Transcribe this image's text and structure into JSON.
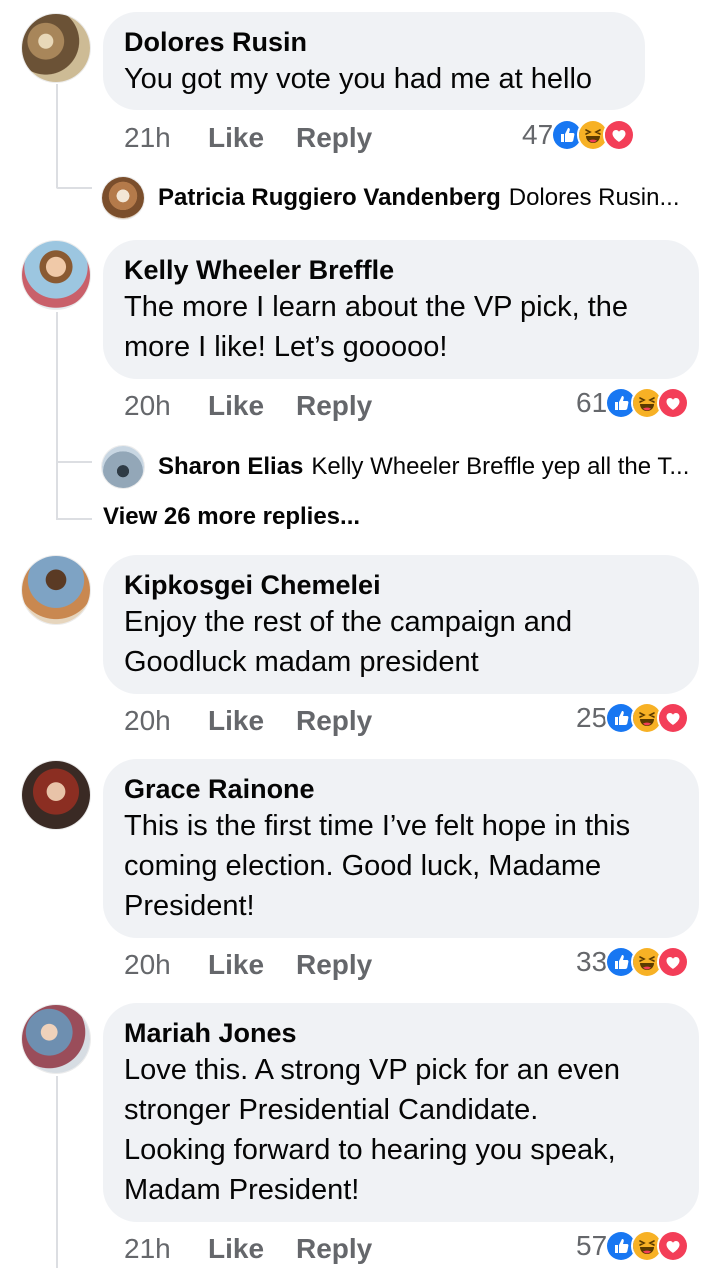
{
  "colors": {
    "like_blue": "#1877f2",
    "haha_yellow": "#f7b125",
    "love_red": "#f33e58",
    "muted_text": "#65676b",
    "bubble_bg": "#f0f2f5"
  },
  "comments": [
    {
      "author": "Dolores Rusin",
      "text": "You got my vote you had me at hello",
      "time": "21h",
      "like_label": "Like",
      "reply_label": "Reply",
      "reaction_count": "47",
      "reactions": [
        "like-icon",
        "haha-icon",
        "love-icon"
      ],
      "reply_preview": {
        "author": "Patricia Ruggiero Vandenberg",
        "text": "Dolores Rusin..."
      }
    },
    {
      "author": "Kelly Wheeler Breffle",
      "text": "The more I learn about the VP pick, the\nmore I like! Let’s gooooo!",
      "time": "20h",
      "like_label": "Like",
      "reply_label": "Reply",
      "reaction_count": "61",
      "reactions": [
        "like-icon",
        "haha-icon",
        "love-icon"
      ],
      "reply_preview": {
        "author": "Sharon Elias",
        "text": "Kelly Wheeler Breffle yep all the T..."
      },
      "view_more": "View 26 more replies..."
    },
    {
      "author": "Kipkosgei Chemelei",
      "text": "Enjoy the rest of the campaign and\nGoodluck madam president",
      "time": "20h",
      "like_label": "Like",
      "reply_label": "Reply",
      "reaction_count": "25",
      "reactions": [
        "like-icon",
        "haha-icon",
        "love-icon"
      ]
    },
    {
      "author": "Grace Rainone",
      "text": "This is the first time I’ve felt hope in this\ncoming election. Good luck, Madame\nPresident!",
      "time": "20h",
      "like_label": "Like",
      "reply_label": "Reply",
      "reaction_count": "33",
      "reactions": [
        "like-icon",
        "haha-icon",
        "love-icon"
      ]
    },
    {
      "author": "Mariah Jones",
      "text": "Love this. A strong VP pick for an even\nstronger Presidential Candidate.\nLooking forward to hearing you speak,\nMadam President!",
      "time": "21h",
      "like_label": "Like",
      "reply_label": "Reply",
      "reaction_count": "57",
      "reactions": [
        "like-icon",
        "haha-icon",
        "love-icon"
      ]
    }
  ]
}
